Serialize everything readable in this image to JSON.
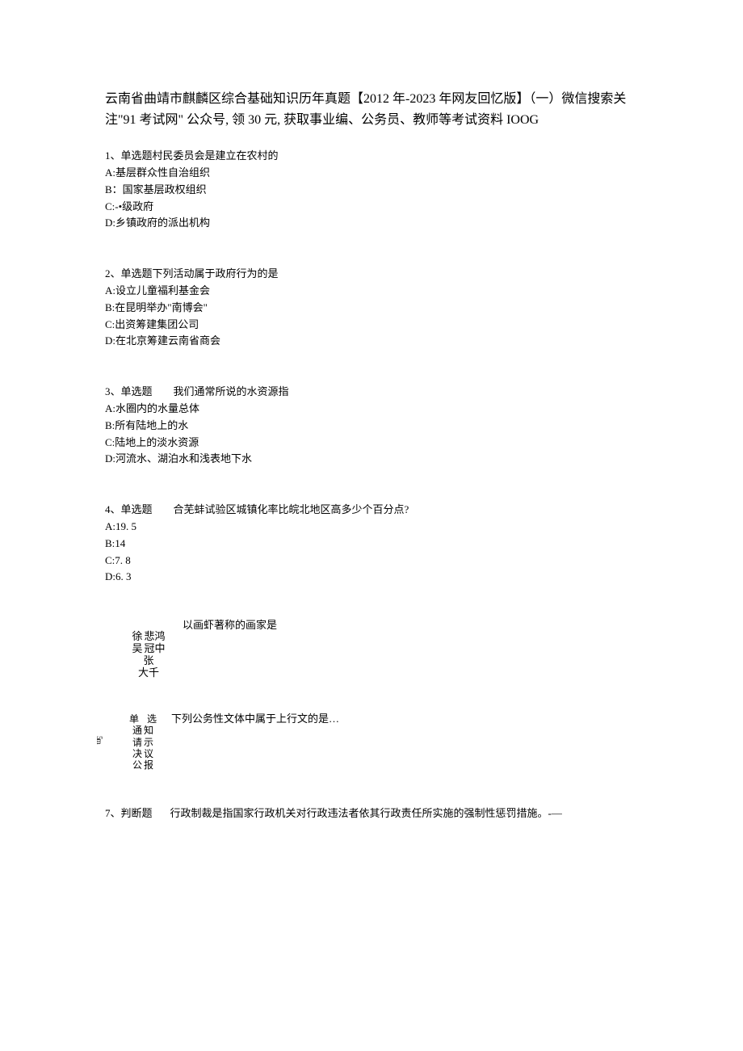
{
  "title": "云南省曲靖市麒麟区综合基础知识历年真题【2012 年-2023 年网友回忆版】（一）微信搜索关注\"91 考试网\" 公众号, 领 30 元, 获取事业编、公务员、教师等考试资料 IOOG",
  "q1": {
    "stem": "1、单选题村民委员会是建立在农村的",
    "a": "A:基层群众性自治组织",
    "b": "B：国家基层政权组织",
    "c": "C:-•级政府",
    "d": "D:乡镇政府的派出机构"
  },
  "q2": {
    "stem": "2、单选题下列活动属于政府行为的是",
    "a": "A:设立儿童福利基金会",
    "b": "B:在昆明举办\"南博会\"",
    "c": "C:出资筹建集团公司",
    "d": "D:在北京筹建云南省商会"
  },
  "q3": {
    "stem": "3、单选题　　我们通常所说的水资源指",
    "a": "A:水圈内的水量总体",
    "b": "B:所有陆地上的水",
    "c": "C:陆地上的淡水资源",
    "d": "D:河流水、湖泊水和浅表地下水"
  },
  "q4": {
    "stem": "4、单选题　　合芜蚌试验区城镇化率比皖北地区高多少个百分点?",
    "a": "A:19. 5",
    "b": "B:14",
    "c": "C:7. 8",
    "d": "D:6. 3"
  },
  "q5": {
    "stem": "以画虾著称的画家是",
    "opt1a": "徐",
    "opt1b": "悲鸿",
    "opt2a": "吴",
    "opt2b": "冠中",
    "opt3a": "张",
    "opt3b": "大千"
  },
  "q6": {
    "label1": "单",
    "label2": "选",
    "stem": "下列公务性文体中属于上行文的是…",
    "r2a": "通",
    "r2b": "知",
    "r3a": "请",
    "r3b": "示",
    "r4a": "决",
    "r4b": "议",
    "r5a": "公",
    "r5b": "报",
    "marker": "5m"
  },
  "q7": {
    "label": "7、判断题",
    "text": "行政制裁是指国家行政机关对行政违法者依其行政责任所实施的强制性惩罚措施。-—"
  }
}
